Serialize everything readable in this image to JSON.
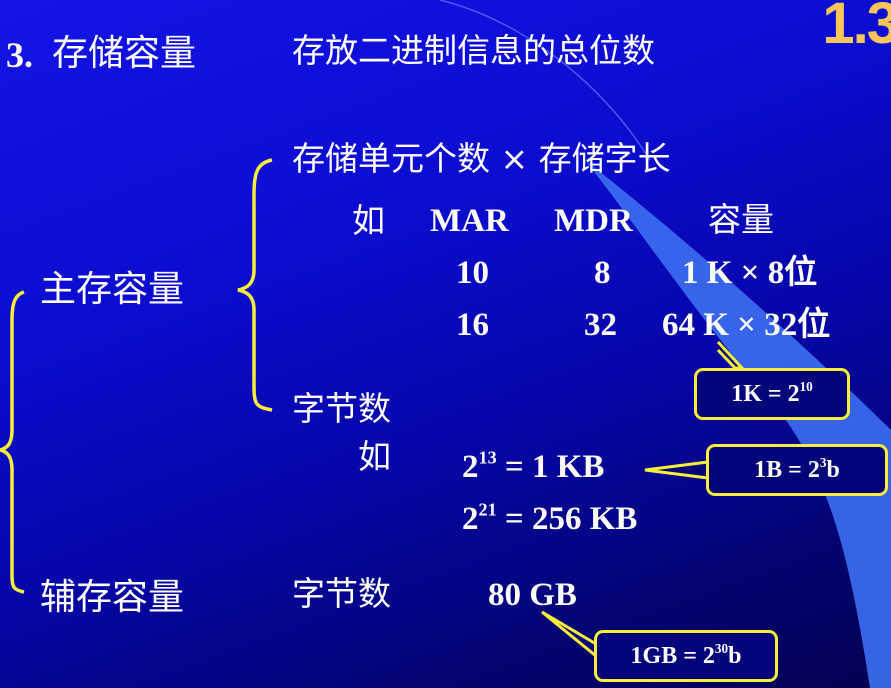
{
  "slide_number": "1.3",
  "heading": {
    "number_label": "3.",
    "title": "存储容量",
    "definition": "存放二进制信息的总位数"
  },
  "main_memory": {
    "label": "主存容量",
    "formula": "存储单元个数 × 存储字长",
    "example_label": "如",
    "table": {
      "headers": [
        "MAR",
        "MDR",
        "容量"
      ],
      "rows": [
        {
          "mar": "10",
          "mdr": "8",
          "capacity": "1 K × 8位"
        },
        {
          "mar": "16",
          "mdr": "32",
          "capacity": "64 K × 32位"
        }
      ]
    },
    "callout_k": {
      "base": "1K = 2",
      "exp": "10",
      "suffix": ""
    },
    "bytes_label": "字节数",
    "bytes_example_label": "如",
    "bytes_examples": [
      {
        "base": "2",
        "exp": "13",
        "result": "= 1 KB"
      },
      {
        "base": "2",
        "exp": "21",
        "result": "= 256 KB"
      }
    ],
    "callout_b": {
      "base": "1B = 2",
      "exp": "3",
      "suffix": "b"
    }
  },
  "aux_memory": {
    "label": "辅存容量",
    "bytes_label": "字节数",
    "value": "80 GB",
    "callout_gb": {
      "base": "1GB = 2",
      "exp": "30",
      "suffix": "b"
    }
  },
  "colors": {
    "background_top": "#1414e6",
    "background_bottom": "#020250",
    "beam": "#3b6cf0",
    "brace": "#f6ee3a",
    "slide_number": "#f7c65a",
    "text": "#ffffff"
  }
}
